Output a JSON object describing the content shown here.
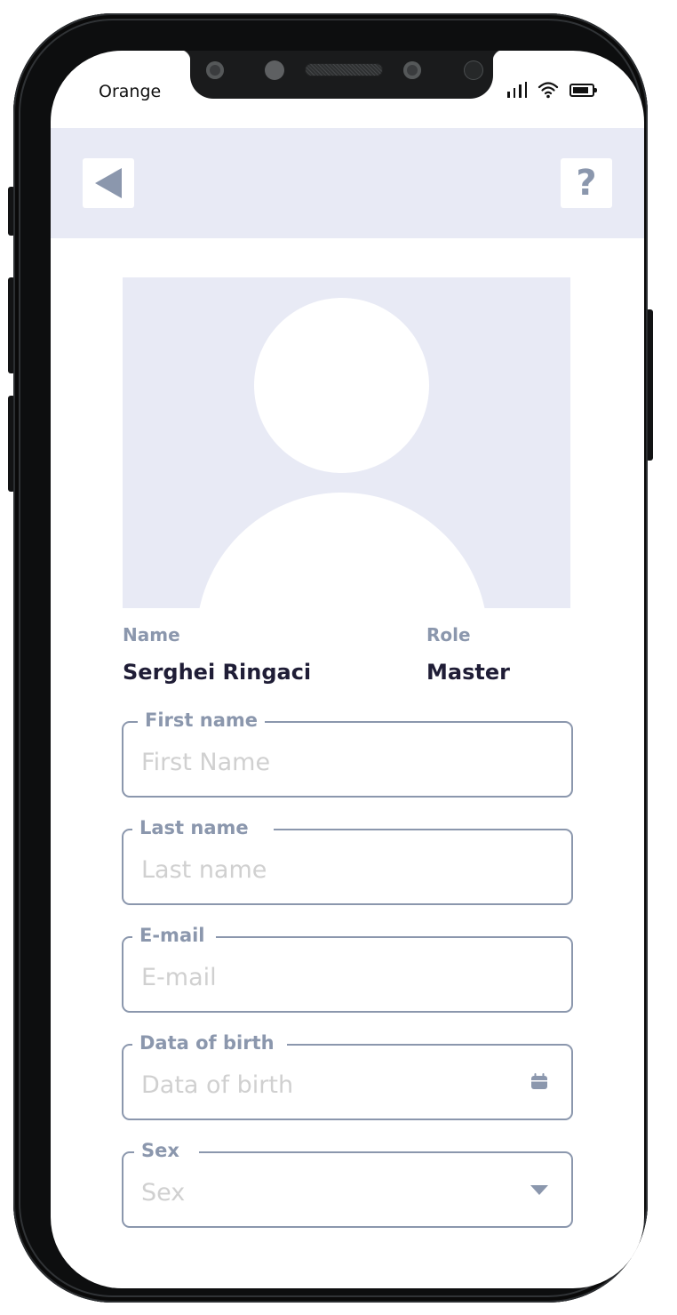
{
  "status_bar": {
    "carrier": "Orange",
    "icons": [
      "signal-icon",
      "wifi-icon",
      "battery-icon"
    ]
  },
  "header": {
    "back_icon": "back-triangle-icon",
    "help_icon": "help-icon",
    "help_glyph": "?"
  },
  "profile": {
    "avatar_icon": "user-placeholder-icon",
    "name_label": "Name",
    "name_value": "Serghei Ringaci",
    "role_label": "Role",
    "role_value": "Master"
  },
  "form": {
    "fields": [
      {
        "label": "First name",
        "placeholder": "First Name",
        "value": ""
      },
      {
        "label": "Last name",
        "placeholder": "Last name",
        "value": ""
      },
      {
        "label": "E-mail",
        "placeholder": "E-mail",
        "value": ""
      },
      {
        "label": "Data of birth",
        "placeholder": "Data of birth",
        "value": "",
        "icon": "calendar-icon"
      },
      {
        "label": "Sex",
        "placeholder": "Sex",
        "value": "",
        "icon": "dropdown-caret-icon"
      }
    ]
  },
  "colors": {
    "accent": "#8b97ad",
    "header_bg": "#e8eaf5",
    "text_dark": "#1f1d36",
    "placeholder": "#d0d0d0"
  }
}
